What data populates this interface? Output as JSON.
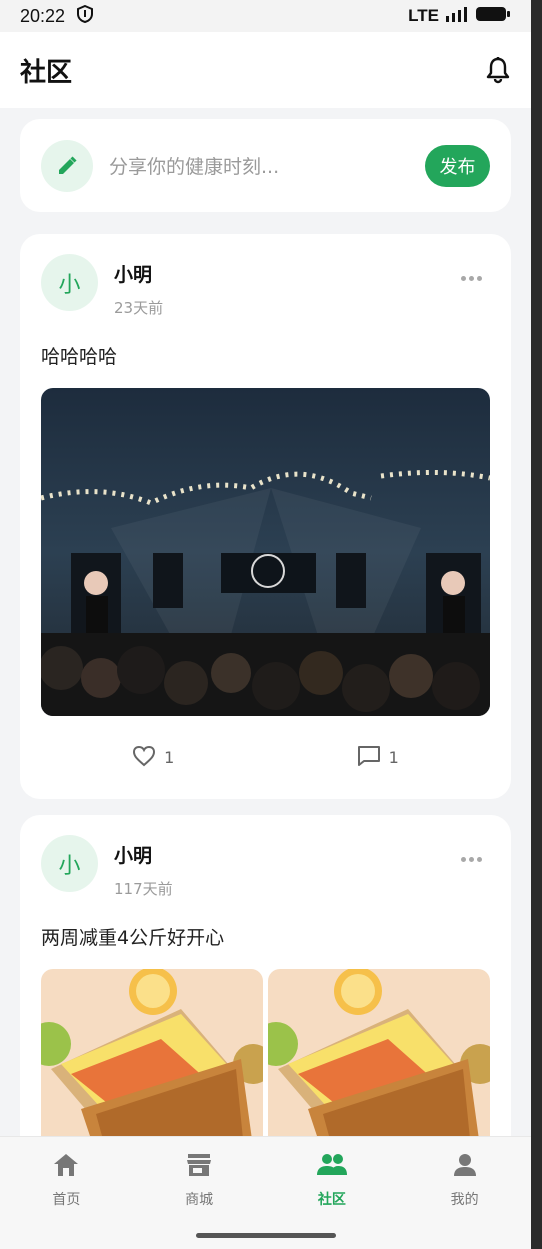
{
  "status_bar": {
    "time": "20:22",
    "network": "LTE"
  },
  "app_bar": {
    "title": "社区"
  },
  "composer": {
    "placeholder": "分享你的健康时刻...",
    "publish_label": "发布"
  },
  "posts": [
    {
      "avatar_char": "小",
      "name": "小明",
      "time": "23天前",
      "text": "哈哈哈哈",
      "likes": "1",
      "comments": "1"
    },
    {
      "avatar_char": "小",
      "name": "小明",
      "time": "117天前",
      "text": "两周减重4公斤好开心"
    }
  ],
  "bottom_nav": {
    "items": [
      {
        "label": "首页",
        "icon": "home-icon"
      },
      {
        "label": "商城",
        "icon": "store-icon"
      },
      {
        "label": "社区",
        "icon": "community-icon",
        "active": true
      },
      {
        "label": "我的",
        "icon": "person-icon"
      }
    ]
  },
  "colors": {
    "accent": "#23a65b",
    "accent_light": "#e6f5ec",
    "background": "#f3f4f6"
  }
}
